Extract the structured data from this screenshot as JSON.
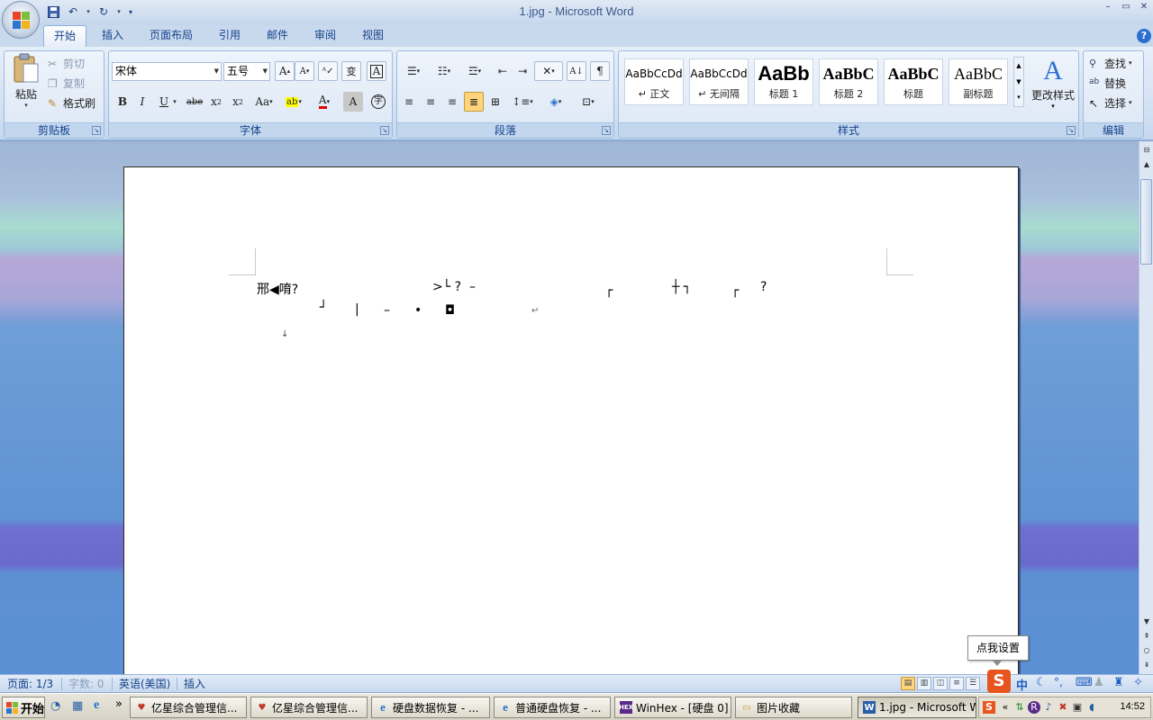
{
  "window": {
    "title": "1.jpg - Microsoft Word",
    "help": "?"
  },
  "tabs": [
    {
      "label": "开始",
      "active": true
    },
    {
      "label": "插入"
    },
    {
      "label": "页面布局"
    },
    {
      "label": "引用"
    },
    {
      "label": "邮件"
    },
    {
      "label": "审阅"
    },
    {
      "label": "视图"
    }
  ],
  "clipboard": {
    "paste": "粘贴",
    "cut": "剪切",
    "copy": "复制",
    "format_painter": "格式刷",
    "group_label": "剪贴板"
  },
  "font": {
    "name": "宋体",
    "size": "五号",
    "group_label": "字体",
    "buttons": [
      "B",
      "I",
      "U",
      "abe",
      "x₂",
      "x²",
      "Aa",
      "A",
      "A",
      "A",
      "变",
      "A"
    ]
  },
  "paragraph": {
    "group_label": "段落"
  },
  "styles": {
    "group_label": "样式",
    "tiles": [
      {
        "preview": "AaBbCcDd",
        "name": "↵ 正文"
      },
      {
        "preview": "AaBbCcDd",
        "name": "↵ 无间隔"
      },
      {
        "preview": "AaBb",
        "name": "标题 1"
      },
      {
        "preview": "AaBbC",
        "name": "标题 2"
      },
      {
        "preview": "AaBbC",
        "name": "标题"
      },
      {
        "preview": "AaBbC",
        "name": "副标题"
      }
    ],
    "change_styles": "更改样式"
  },
  "editing": {
    "find": "查找",
    "replace": "替换",
    "select": "选择",
    "group_label": "编辑"
  },
  "document": {
    "line1_a": "邢◀唷?",
    "line1_b": ">└ ?  –",
    "line1_c": "┌",
    "line1_d": "┼ ┐",
    "line1_e": "┌",
    "line1_f": "?",
    "line2_a": "┘",
    "line2_b": "|",
    "line2_c": "–",
    "line2_d": "•",
    "line2_e": "◘",
    "line2_f": "↵",
    "line3": "↓"
  },
  "status": {
    "page": "页面: 1/3",
    "words": "字数: 0",
    "language": "英语(美国)",
    "mode": "插入"
  },
  "tooltip": "点我设置",
  "taskbar": {
    "start": "开始",
    "more": "»",
    "tasks": [
      {
        "label": "亿星综合管理信..."
      },
      {
        "label": "亿星综合管理信..."
      },
      {
        "label": "硬盘数据恢复 - ..."
      },
      {
        "label": "普通硬盘恢复 - ..."
      },
      {
        "label": "WinHex - [硬盘 0]"
      },
      {
        "label": "图片收藏"
      },
      {
        "label": "1.jpg - Microsoft W..."
      }
    ],
    "ime": "中",
    "clock": "14:52"
  }
}
